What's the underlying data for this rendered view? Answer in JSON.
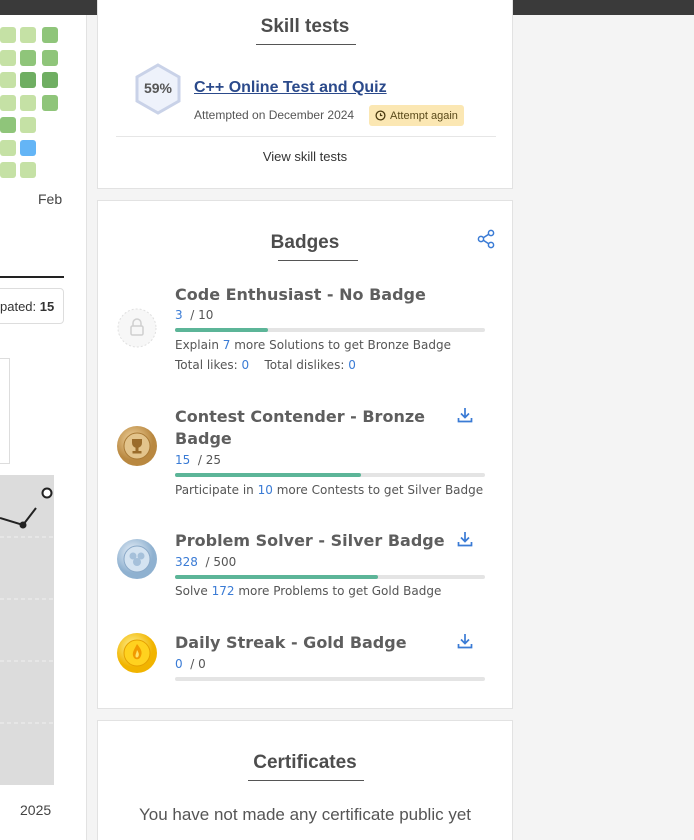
{
  "left_panel": {
    "month_label": "Feb",
    "repeated_label": "pated:",
    "repeated_value": "15",
    "year_label": "2025"
  },
  "skill_tests": {
    "heading": "Skill tests",
    "score": "59%",
    "test_name": "C++ Online Test and Quiz",
    "attempted": "Attempted on December 2024",
    "attempt_again": "Attempt again",
    "view_all": "View skill tests"
  },
  "badges": {
    "heading": "Badges",
    "items": [
      {
        "title": "Code Enthusiast - No Badge",
        "current": "3",
        "total": "/ 10",
        "progress": 0.3,
        "note_prefix": "Explain",
        "note_num": "7",
        "note_suffix": "more Solutions to get Bronze Badge",
        "likes_label": "Total likes:",
        "likes": "0",
        "dislikes_label": "Total dislikes:",
        "dislikes": "0",
        "medal": "lock-icon"
      },
      {
        "title_line1": "Contest Contender - Bronze",
        "title_line2": "Badge",
        "current": "15",
        "total": "/ 25",
        "progress": 0.6,
        "note_prefix": "Participate in",
        "note_num": "10",
        "note_suffix": "more Contests to get Silver Badge",
        "medal": "bronze-medal-icon"
      },
      {
        "title": "Problem Solver - Silver Badge",
        "current": "328",
        "total": "/ 500",
        "progress": 0.656,
        "note_prefix": "Solve",
        "note_num": "172",
        "note_suffix": "more Problems to get Gold Badge",
        "medal": "silver-medal-icon"
      },
      {
        "title": "Daily Streak - Gold Badge",
        "current": "0",
        "total": "/ 0",
        "progress": 0,
        "medal": "gold-medal-icon"
      }
    ]
  },
  "certificates": {
    "heading": "Certificates",
    "empty_text": "You have not made any certificate public yet"
  },
  "colors": {
    "link": "#2b4a8b",
    "accent_blue": "#3a7bd5",
    "progress": "#5cb598",
    "attempt_bg": "#fbe7b3"
  }
}
